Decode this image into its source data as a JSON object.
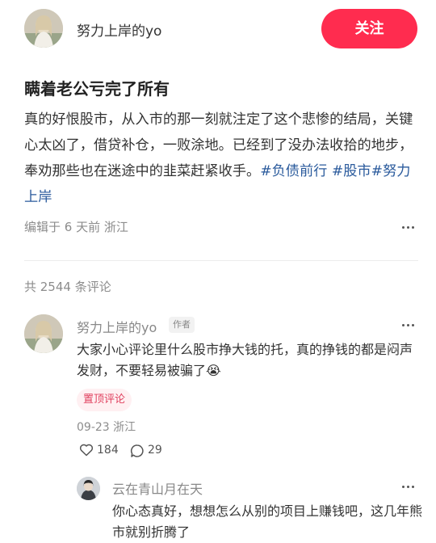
{
  "author": {
    "name": "努力上岸的yo",
    "follow_label": "关注"
  },
  "post": {
    "title": "瞒着老公亏完了所有",
    "body": "真的好恨股市，从入市的那一刻就注定了这个悲惨的结局，关键心太凶了，借贷补仓，一败涂地。已经到了没办法收拾的地步，奉劝那些也在迷途中的韭菜赶紧收手。",
    "tags": [
      "#负债前行",
      "#股市",
      "#努力上岸"
    ],
    "meta": "编辑于 6 天前 浙江"
  },
  "comments_header": "共 2544 条评论",
  "comments": [
    {
      "name": "努力上岸的yo",
      "badge": "作者",
      "text": "大家小心评论里什么股市挣大钱的托，真的挣钱的都是闷声发财，不要轻易被骗了",
      "emoji": "😭",
      "pinned": "置顶评论",
      "meta": "09-23 浙江",
      "likes": "184",
      "replies": "29"
    },
    {
      "name": "云在青山月在天",
      "text": "你心态真好，想想怎么从别的项目上赚钱吧，这几年熊市就别折腾了"
    }
  ]
}
